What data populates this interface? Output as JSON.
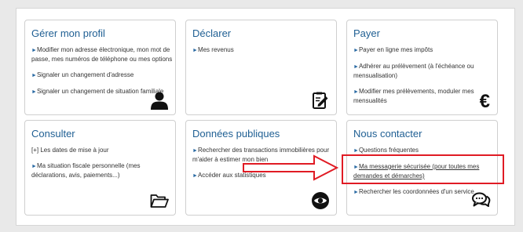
{
  "cards": [
    {
      "title": "Gérer mon profil",
      "items": [
        "Modifier mon adresse électronique, mon mot de passe, mes numéros de téléphone ou mes options",
        "Signaler un changement d'adresse",
        "Signaler un changement de situation familiale"
      ],
      "icon": "user-icon"
    },
    {
      "title": "Déclarer",
      "items": [
        "Mes revenus"
      ],
      "icon": "document-edit-icon"
    },
    {
      "title": "Payer",
      "items": [
        "Payer en ligne mes impôts",
        "Adhérer au prélèvement (à l'échéance ou mensualisation)",
        "Modifier mes prélèvements, moduler mes mensualités"
      ],
      "icon": "euro-icon",
      "icon_text": "€"
    },
    {
      "title": "Consulter",
      "items": [
        "Les dates de mise à jour",
        "Ma situation fiscale personnelle (mes déclarations, avis, paiements...)"
      ],
      "first_prefix": "[+]",
      "icon": "folder-icon"
    },
    {
      "title": "Données publiques",
      "items": [
        "Rechercher des transactions immobilières pour m'aider à estimer mon bien",
        "Accéder aux statistiques"
      ],
      "icon": "eye-icon"
    },
    {
      "title": "Nous contacter",
      "items": [
        "Questions fréquentes",
        "Ma messagerie sécurisée (pour toutes mes demandes et démarches)",
        "Rechercher les coordonnées d'un service"
      ],
      "icon": "chat-icon"
    }
  ],
  "bullet": "►",
  "colors": {
    "title": "#1f5f93",
    "bullet": "#2a6aa3",
    "highlight": "#e01b24",
    "text": "#333333"
  }
}
